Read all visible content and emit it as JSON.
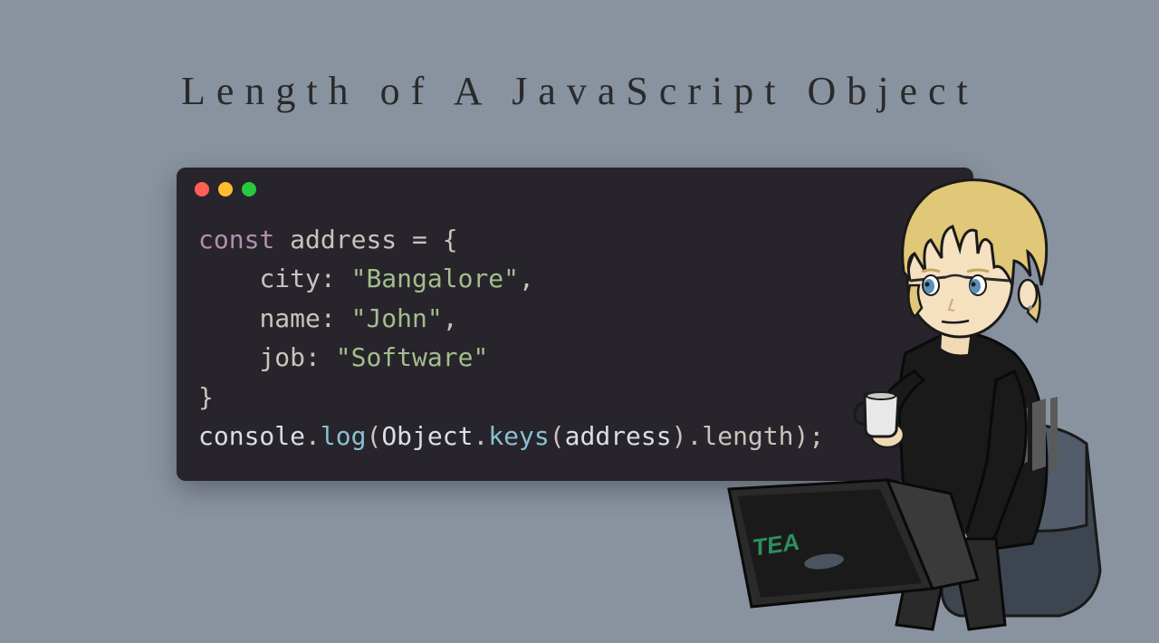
{
  "title": "Length of A JavaScript Object",
  "code": {
    "line1": {
      "kw": "const",
      "ident": "address",
      "op": "= {"
    },
    "line2": {
      "key": "city",
      "colon": ":",
      "val": "\"Bangalore\"",
      "comma": ","
    },
    "line3": {
      "key": "name",
      "colon": ":",
      "val": "\"John\"",
      "comma": ","
    },
    "line4": {
      "key": "job",
      "colon": ":",
      "val": "\"Software\""
    },
    "line5": "}",
    "line6": {
      "obj1": "console",
      "dot1": ".",
      "m1": "log",
      "p1": "(",
      "obj2": "Object",
      "dot2": ".",
      "m2": "keys",
      "p2": "(",
      "arg": "address",
      "p3": ")",
      "dot3": ".",
      "m3": "length",
      "p4": ");"
    }
  },
  "character": {
    "sticker_text": "TEA"
  }
}
